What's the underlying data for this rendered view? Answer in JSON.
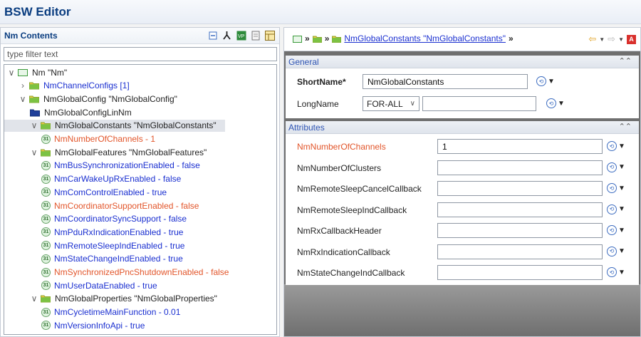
{
  "app": {
    "title": "BSW Editor"
  },
  "left_panel": {
    "title": "Nm Contents",
    "filter_placeholder": "type filter text",
    "tree": [
      {
        "label": "Nm \"Nm\"",
        "color": "dark",
        "icon": "module-icon",
        "twisty": "expanded"
      },
      {
        "label": "NmChannelConfigs [1]",
        "color": "blue",
        "icon": "folder-icon",
        "twisty": "collapsed"
      },
      {
        "label": "NmGlobalConfig \"NmGlobalConfig\"",
        "color": "dark",
        "icon": "folder-icon",
        "twisty": "expanded"
      },
      {
        "label": "NmGlobalConfigLinNm",
        "color": "dark",
        "icon": "folder-dark-icon",
        "twisty": "none"
      },
      {
        "label": "NmGlobalConstants \"NmGlobalConstants\"",
        "color": "dark",
        "icon": "folder-icon",
        "twisty": "expanded",
        "selected": true
      },
      {
        "label": "NmNumberOfChannels - 1",
        "color": "red",
        "icon": "value-icon",
        "twisty": "none"
      },
      {
        "label": "NmGlobalFeatures \"NmGlobalFeatures\"",
        "color": "dark",
        "icon": "folder-icon",
        "twisty": "expanded"
      },
      {
        "label": "NmBusSynchronizationEnabled - false",
        "color": "blue",
        "icon": "value-icon",
        "twisty": "none"
      },
      {
        "label": "NmCarWakeUpRxEnabled - false",
        "color": "blue",
        "icon": "value-icon",
        "twisty": "none"
      },
      {
        "label": "NmComControlEnabled - true",
        "color": "blue",
        "icon": "value-icon",
        "twisty": "none"
      },
      {
        "label": "NmCoordinatorSupportEnabled - false",
        "color": "red",
        "icon": "value-icon",
        "twisty": "none"
      },
      {
        "label": "NmCoordinatorSyncSupport - false",
        "color": "blue",
        "icon": "value-icon",
        "twisty": "none"
      },
      {
        "label": "NmPduRxIndicationEnabled - true",
        "color": "blue",
        "icon": "value-icon",
        "twisty": "none"
      },
      {
        "label": "NmRemoteSleepIndEnabled - true",
        "color": "blue",
        "icon": "value-icon",
        "twisty": "none"
      },
      {
        "label": "NmStateChangeIndEnabled - true",
        "color": "blue",
        "icon": "value-icon",
        "twisty": "none"
      },
      {
        "label": "NmSynchronizedPncShutdownEnabled - false",
        "color": "red",
        "icon": "value-icon",
        "twisty": "none"
      },
      {
        "label": "NmUserDataEnabled - true",
        "color": "blue",
        "icon": "value-icon",
        "twisty": "none"
      },
      {
        "label": "NmGlobalProperties \"NmGlobalProperties\"",
        "color": "dark",
        "icon": "folder-icon",
        "twisty": "expanded"
      },
      {
        "label": "NmCycletimeMainFunction - 0.01",
        "color": "blue",
        "icon": "value-icon",
        "twisty": "none"
      },
      {
        "label": "NmVersionInfoApi - true",
        "color": "blue",
        "icon": "value-icon",
        "twisty": "none"
      }
    ]
  },
  "editor": {
    "breadcrumb_link": "NmGlobalConstants \"NmGlobalConstants\"",
    "general": {
      "title": "General",
      "shortname_label": "ShortName*",
      "shortname_value": "NmGlobalConstants",
      "longname_label": "LongName",
      "language": "FOR-ALL",
      "longname_value": ""
    },
    "attributes": {
      "title": "Attributes",
      "rows": [
        {
          "label": "NmNumberOfChannels",
          "value": "1",
          "color": "red"
        },
        {
          "label": "NmNumberOfClusters",
          "value": "",
          "color": "dark"
        },
        {
          "label": "NmRemoteSleepCancelCallback",
          "value": "",
          "color": "dark"
        },
        {
          "label": "NmRemoteSleepIndCallback",
          "value": "",
          "color": "dark"
        },
        {
          "label": "NmRxCallbackHeader",
          "value": "",
          "color": "dark"
        },
        {
          "label": "NmRxIndicationCallback",
          "value": "",
          "color": "dark"
        },
        {
          "label": "NmStateChangeIndCallback",
          "value": "",
          "color": "dark"
        }
      ]
    }
  },
  "colors": {
    "title": "#0a3d80",
    "link": "#1a2fd0",
    "error": "#e2552a",
    "section_title": "#2f55b4"
  }
}
